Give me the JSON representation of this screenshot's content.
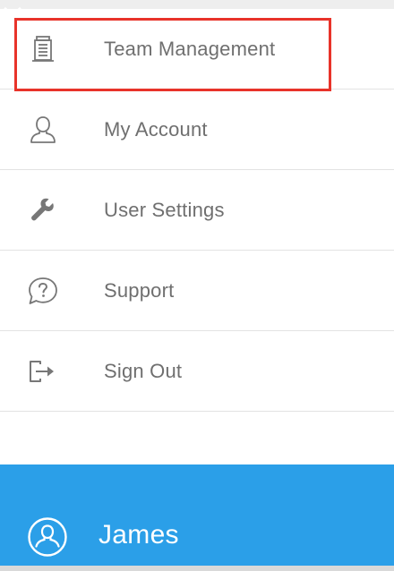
{
  "menu": {
    "items": [
      {
        "label": "Team Management",
        "icon": "building-icon"
      },
      {
        "label": "My Account",
        "icon": "user-icon"
      },
      {
        "label": "User Settings",
        "icon": "wrench-icon"
      },
      {
        "label": "Support",
        "icon": "help-bubble-icon"
      },
      {
        "label": "Sign Out",
        "icon": "sign-out-icon"
      }
    ]
  },
  "user": {
    "name": "James",
    "icon": "user-circle-icon",
    "toggle_icon": "chevron-down-icon"
  },
  "colors": {
    "accent": "#2b9fe8",
    "highlight_border": "#e8332a",
    "label_text": "#6f6f6f",
    "icon_stroke": "#777777"
  }
}
